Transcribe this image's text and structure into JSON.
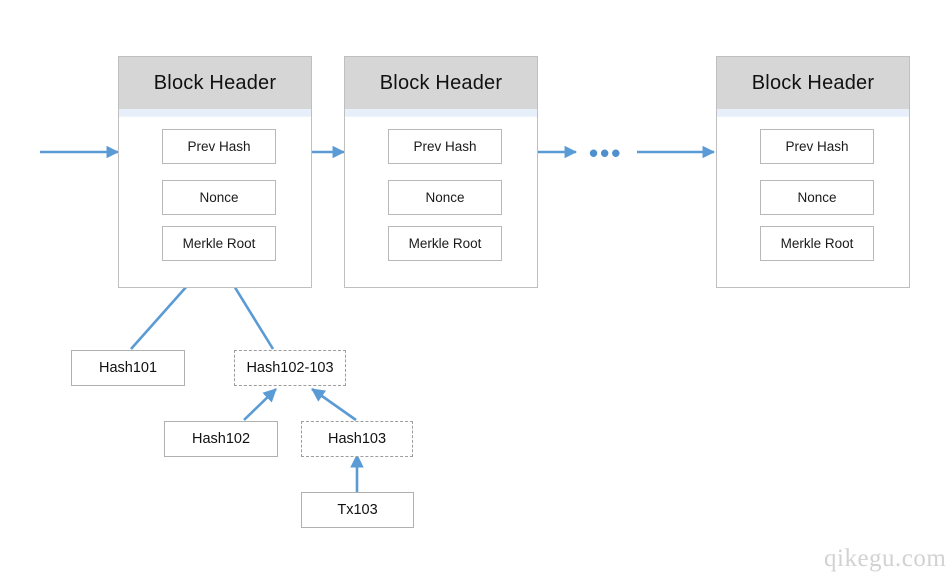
{
  "diagram": {
    "title": "Blockchain block header and Merkle tree diagram",
    "accent_color": "#4e8fcc",
    "header_bg": "#d6d6d6",
    "block_border": "#bfbfbf"
  },
  "blocks": [
    {
      "header_label": "Block Header",
      "fields": [
        {
          "label": "Prev Hash"
        },
        {
          "label": "Nonce"
        },
        {
          "label": "Merkle Root"
        }
      ]
    },
    {
      "header_label": "Block Header",
      "fields": [
        {
          "label": "Prev Hash"
        },
        {
          "label": "Nonce"
        },
        {
          "label": "Merkle Root"
        }
      ]
    },
    {
      "header_label": "Block Header",
      "fields": [
        {
          "label": "Prev Hash"
        },
        {
          "label": "Nonce"
        },
        {
          "label": "Merkle Root"
        }
      ]
    }
  ],
  "chain": {
    "ellipsis": "•••"
  },
  "merkle_nodes": [
    {
      "label": "Hash101",
      "style": "solid"
    },
    {
      "label": "Hash102-103",
      "style": "dashed"
    },
    {
      "label": "Hash102",
      "style": "solid"
    },
    {
      "label": "Hash103",
      "style": "dashed"
    },
    {
      "label": "Tx103",
      "style": "solid"
    }
  ],
  "watermark": {
    "text": "qikegu.com"
  }
}
